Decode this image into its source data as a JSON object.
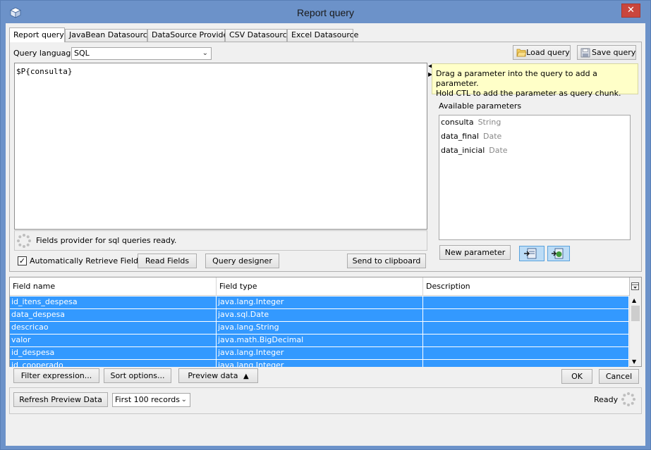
{
  "window": {
    "title": "Report query"
  },
  "tabs": [
    {
      "label": "Report query"
    },
    {
      "label": "JavaBean Datasource"
    },
    {
      "label": "DataSource Provider"
    },
    {
      "label": "CSV Datasource"
    },
    {
      "label": "Excel Datasource"
    }
  ],
  "query": {
    "language_label": "Query language",
    "language_value": "SQL",
    "text": "$P{consulta}",
    "load_label": "Load query",
    "save_label": "Save query",
    "status": "Fields provider for sql queries ready.",
    "auto_retrieve_label": "Automatically Retrieve Fields",
    "auto_retrieve_checked": true,
    "read_fields_label": "Read Fields",
    "query_designer_label": "Query designer",
    "send_clipboard_label": "Send to clipboard"
  },
  "params": {
    "hint_line1": "Drag a parameter into the query to add a parameter.",
    "hint_line2": "Hold CTL to add the parameter as query chunk.",
    "available_label": "Available parameters",
    "items": [
      {
        "name": "consulta",
        "type": "String"
      },
      {
        "name": "data_final",
        "type": "Date"
      },
      {
        "name": "data_inicial",
        "type": "Date"
      }
    ],
    "new_param_label": "New parameter"
  },
  "fields": {
    "columns": [
      "Field name",
      "Field type",
      "Description"
    ],
    "rows": [
      {
        "name": "id_itens_despesa",
        "type": "java.lang.Integer",
        "desc": ""
      },
      {
        "name": "data_despesa",
        "type": "java.sql.Date",
        "desc": ""
      },
      {
        "name": "descricao",
        "type": "java.lang.String",
        "desc": ""
      },
      {
        "name": "valor",
        "type": "java.math.BigDecimal",
        "desc": ""
      },
      {
        "name": "id_despesa",
        "type": "java.lang.Integer",
        "desc": ""
      },
      {
        "name": "id_cooperado",
        "type": "java.lang.Integer",
        "desc": ""
      }
    ]
  },
  "actions": {
    "filter_label": "Filter expression...",
    "sort_label": "Sort options...",
    "preview_label": "Preview data",
    "ok_label": "OK",
    "cancel_label": "Cancel"
  },
  "preview": {
    "refresh_label": "Refresh Preview Data",
    "records_value": "First 100 records",
    "status": "Ready"
  },
  "colors": {
    "titlebar": "#6c92c9",
    "selection": "#3399ff",
    "hint_bg": "#ffffc8"
  }
}
